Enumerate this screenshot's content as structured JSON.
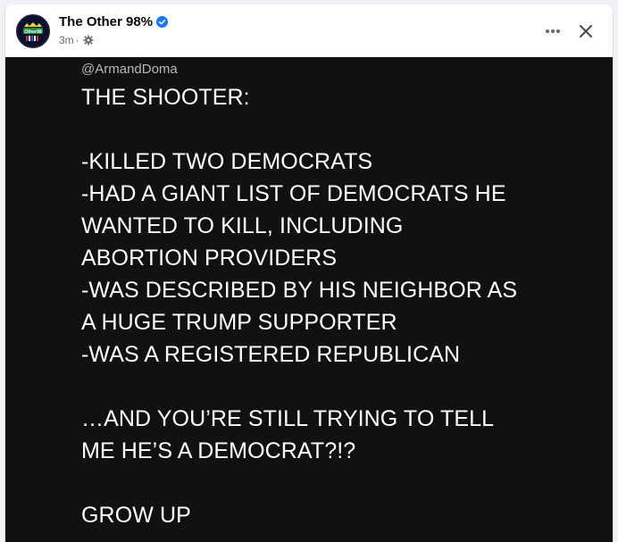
{
  "post": {
    "page_name": "The Other 98%",
    "verified_icon": "verified-badge-icon",
    "time": "3m",
    "separator": "·",
    "privacy_icon": "gear-icon",
    "actions": {
      "more_icon": "ellipsis-icon",
      "close_icon": "close-icon"
    },
    "avatar_text": "Other98"
  },
  "image": {
    "handle": "@ArmandDoma",
    "title": "THE SHOOTER:",
    "lines": [
      "-KILLED TWO DEMOCRATS",
      "-HAD A GIANT LIST OF DEMOCRATS HE",
      "WANTED TO KILL, INCLUDING",
      "ABORTION PROVIDERS",
      "-WAS DESCRIBED BY HIS NEIGHBOR AS",
      "A HUGE TRUMP SUPPORTER",
      "-WAS A REGISTERED REPUBLICAN"
    ],
    "closing": [
      "…AND YOU’RE STILL TRYING TO TELL",
      "ME HE’S A DEMOCRAT?!?"
    ],
    "sign_off": "GROW UP"
  },
  "colors": {
    "verified": "#1877f2",
    "image_background": "#111111",
    "text": "#ffffff",
    "meta": "#65676b"
  }
}
